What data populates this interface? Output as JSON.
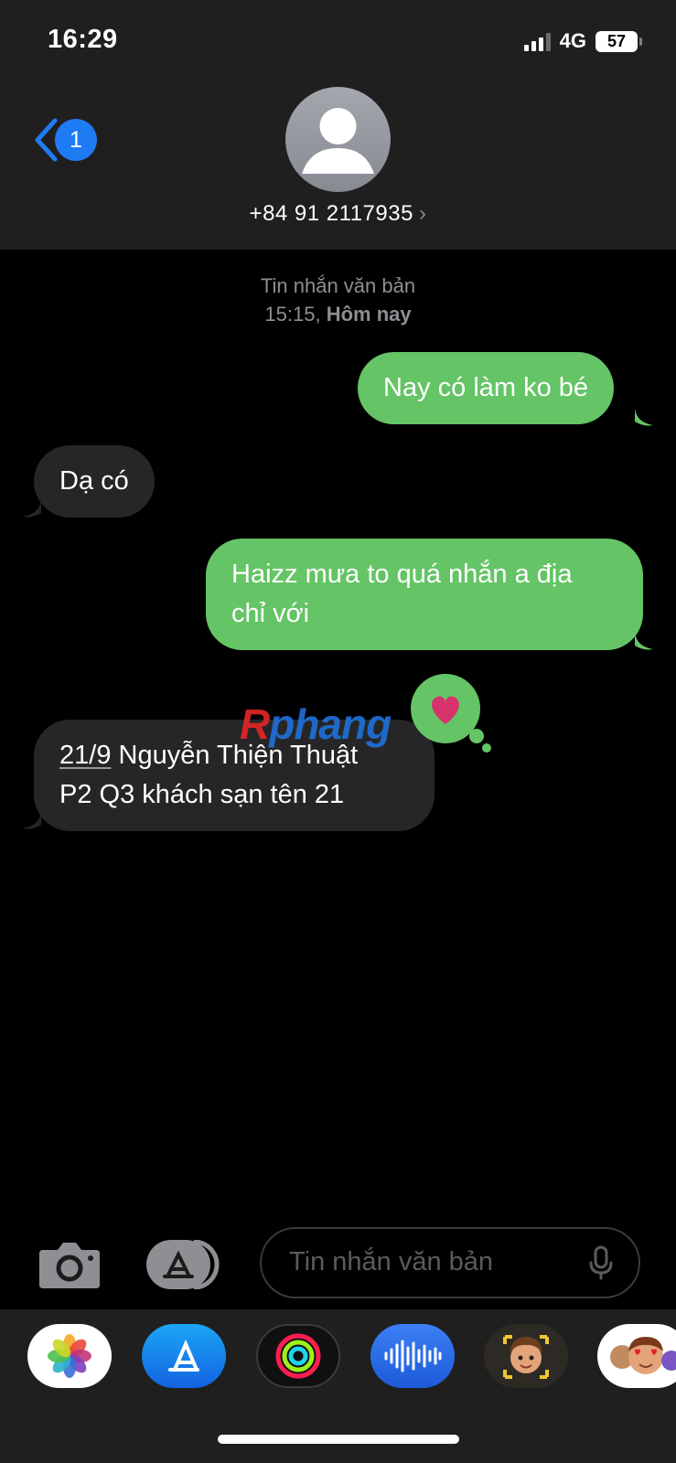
{
  "status_bar": {
    "time": "16:29",
    "network": "4G",
    "battery": "57"
  },
  "nav": {
    "back_badge": "1",
    "contact": "+84 91 2117935",
    "contact_chevron": "›"
  },
  "meta": {
    "type": "Tin nhắn văn bản",
    "time": "15:15,",
    "day": "Hôm nay"
  },
  "messages": [
    {
      "direction": "out",
      "text": "Nay có làm ko bé"
    },
    {
      "direction": "in",
      "text": "Dạ có"
    },
    {
      "direction": "out",
      "line1": "Haizz mưa to quá nhắn a địa",
      "line2": "chỉ với"
    },
    {
      "direction": "in",
      "link": "21/9",
      "line1_rest": " Nguyễn Thiện Thuật",
      "line2": "P2 Q3 khách sạn tên 21",
      "tapback": "heart"
    }
  ],
  "watermark": {
    "first": "R",
    "rest": "phang"
  },
  "composer": {
    "placeholder": "Tin nhắn văn bản"
  },
  "app_tray": [
    "photos",
    "app-store",
    "activity",
    "audio-message",
    "memoji",
    "memoji-stickers"
  ],
  "colors": {
    "outgoing": "#65c466",
    "incoming": "#262628",
    "accent": "#1e7bf3",
    "heart": "#d6336c"
  }
}
